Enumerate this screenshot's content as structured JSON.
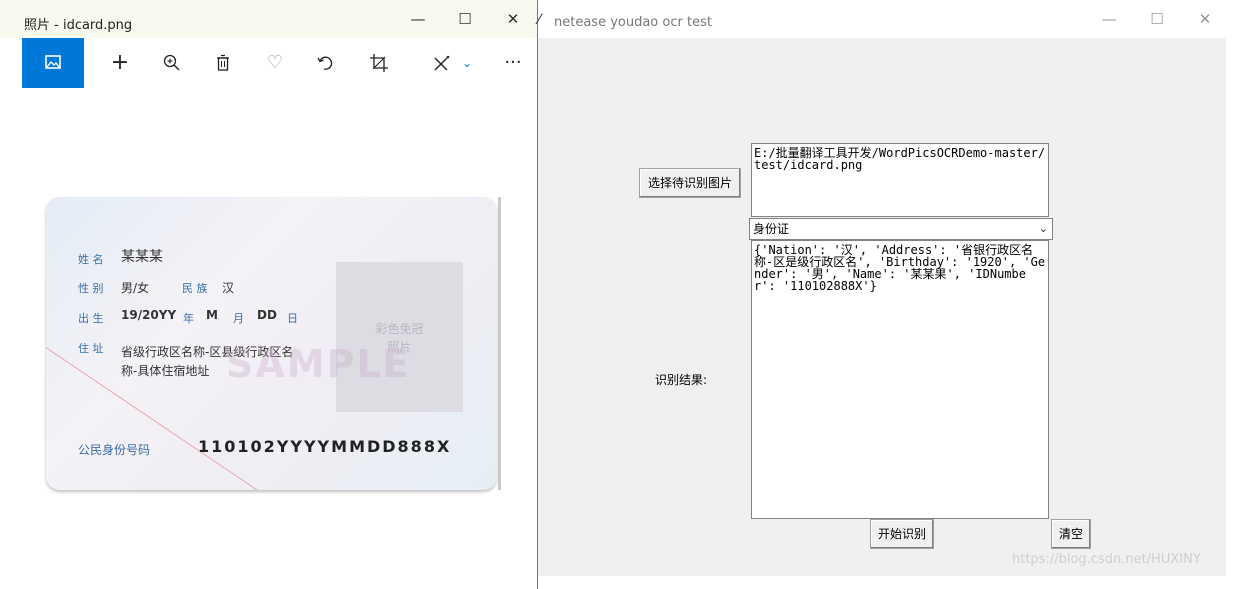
{
  "photos_window": {
    "title": "照片 - idcard.png",
    "controls": {
      "minimize": "—",
      "maximize": "☐",
      "close": "✕"
    },
    "toolbar": [
      "image-icon",
      "add-icon",
      "zoom-in-icon",
      "delete-icon",
      "favorite-icon",
      "rotate-icon",
      "crop-icon",
      "edit-icon",
      "more-icon"
    ]
  },
  "id_card": {
    "name_label": "姓 名",
    "name_value": "某某某",
    "gender_label": "性 别",
    "gender_value": "男/女",
    "nation_label": "民 族",
    "nation_value": "汉",
    "birth_label": "出 生",
    "birth_year": "19/20YY",
    "year_char": "年",
    "birth_month": "M",
    "month_char": "月",
    "birth_day": "DD",
    "day_char": "日",
    "address_label": "住 址",
    "address_line1": "省级行政区名称-区县级行政区名",
    "address_line2": "称-具体住宿地址",
    "photo_text": "彩色免冠\n照片",
    "sample_text": "SAMPLE",
    "id_label": "公民身份号码",
    "id_number": "110102YYYYMMDD888X"
  },
  "tk_window": {
    "title": "netease youdao ocr test",
    "controls": {
      "minimize": "—",
      "maximize": "☐",
      "close": "✕"
    },
    "select_button": "选择待识别图片",
    "path_text": "E:/批量翻译工具开发/WordPicsOCRDemo-master/test/idcard.png",
    "combo_value": "身份证",
    "result_label": "识别结果:",
    "result_text": "{'Nation': '汉', 'Address': '省银行政区名称-区是级行政区名', 'Birthday': '1920', 'Gender': '男', 'Name': '某某果', 'IDNumber': '110102888X'}",
    "start_button": "开始识别",
    "clear_button": "清空"
  },
  "watermark": "https://blog.csdn.net/HUXINY"
}
